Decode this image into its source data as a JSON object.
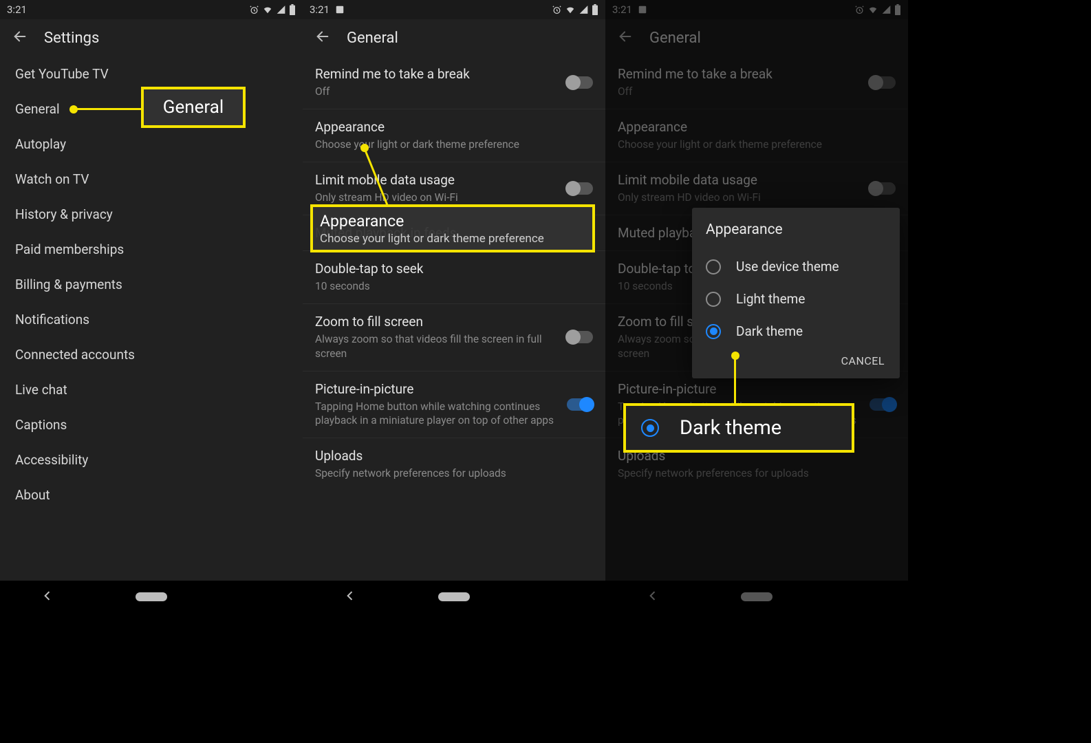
{
  "status": {
    "time": "3:21"
  },
  "phone1": {
    "title": "Settings",
    "items": [
      "Get YouTube TV",
      "General",
      "Autoplay",
      "Watch on TV",
      "History & privacy",
      "Paid memberships",
      "Billing & payments",
      "Notifications",
      "Connected accounts",
      "Live chat",
      "Captions",
      "Accessibility",
      "About"
    ]
  },
  "phone2": {
    "title": "General",
    "rows": [
      {
        "t": "Remind me to take a break",
        "s": "Off",
        "toggle": "off"
      },
      {
        "t": "Appearance",
        "s": "Choose your light or dark theme preference"
      },
      {
        "t": "Limit mobile data usage",
        "s": "Only stream HD video on Wi-Fi",
        "toggle": "off"
      },
      {
        "t": "Muted playback in feeds"
      },
      {
        "t": "Double-tap to seek",
        "s": "10 seconds"
      },
      {
        "t": "Zoom to fill screen",
        "s": "Always zoom so that videos fill the screen in full screen",
        "toggle": "off"
      },
      {
        "t": "Picture-in-picture",
        "s": "Tapping Home button while watching continues playback in a miniature player on top of other apps",
        "toggle": "on"
      },
      {
        "t": "Uploads",
        "s": "Specify network preferences for uploads"
      }
    ]
  },
  "phone3": {
    "title": "General",
    "dialog": {
      "title": "Appearance",
      "options": [
        "Use device theme",
        "Light theme",
        "Dark theme"
      ],
      "selected": 2,
      "cancel": "CANCEL"
    }
  },
  "callouts": {
    "general": "General",
    "appearance_t": "Appearance",
    "appearance_s": "Choose your light or dark theme preference",
    "dark": "Dark theme"
  }
}
